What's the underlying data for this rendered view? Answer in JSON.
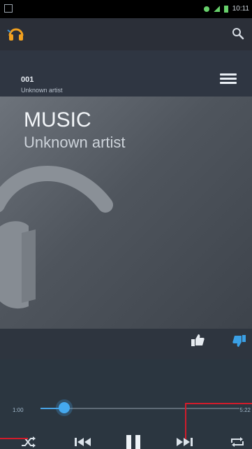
{
  "status_bar": {
    "time": "10:11"
  },
  "action_bar": {
    "app_icon": "headphones-app-icon",
    "search_icon": "search-icon"
  },
  "now_playing": {
    "track_number": "001",
    "artist": "Unknown artist"
  },
  "artwork": {
    "title": "MUSIC",
    "artist": "Unknown artist",
    "placeholder_icon": "headphones-icon"
  },
  "rating": {
    "thumb_up_icon": "thumb-up-icon",
    "thumb_down_icon": "thumb-down-icon"
  },
  "playback": {
    "current_time": "1:00",
    "total_time": "5:22",
    "progress": 0.12
  },
  "controls": {
    "shuffle_icon": "shuffle-icon",
    "previous_icon": "skip-previous-icon",
    "pause_icon": "pause-icon",
    "next_icon": "skip-next-icon",
    "repeat_icon": "repeat-icon"
  },
  "colors": {
    "background": "#2d3440",
    "accent": "#45a9ef",
    "annotation": "#d21c2b"
  }
}
